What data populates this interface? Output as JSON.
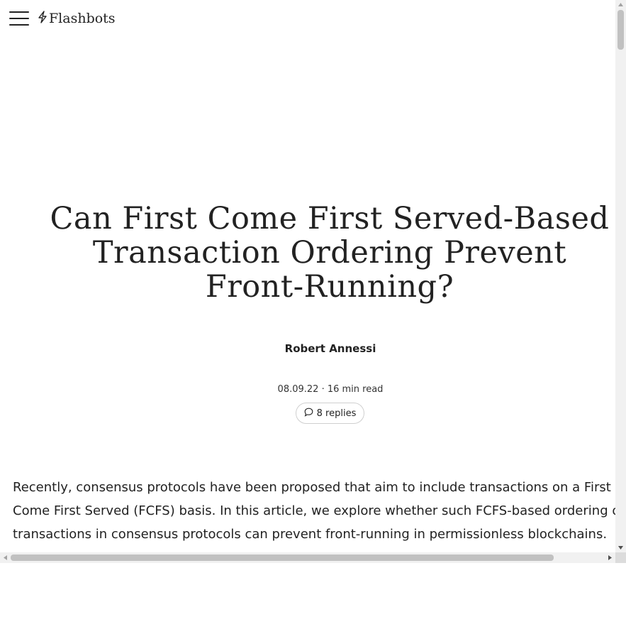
{
  "header": {
    "logo_text": "Flashbots",
    "menu_icon": "hamburger-menu-icon",
    "logo_icon": "lightning-bolt-icon"
  },
  "article": {
    "title": "Can First Come First Served-Based Transaction Ordering Prevent Front-Running?",
    "author": "Robert Annessi",
    "meta": "08.09.22 · 16 min read",
    "replies_label": "8 replies",
    "replies_icon": "speech-bubble-icon",
    "intro": "Recently, consensus protocols have been proposed that aim to include transactions on a First Come First Served (FCFS) basis. In this article, we explore whether such FCFS-based ordering of transactions in consensus protocols can prevent front-running in permissionless blockchains."
  },
  "colors": {
    "text": "#222222",
    "scrollbar_track": "#f1f1f1",
    "scrollbar_thumb": "#c1c1c1",
    "pill_border": "#cfcfcf"
  }
}
